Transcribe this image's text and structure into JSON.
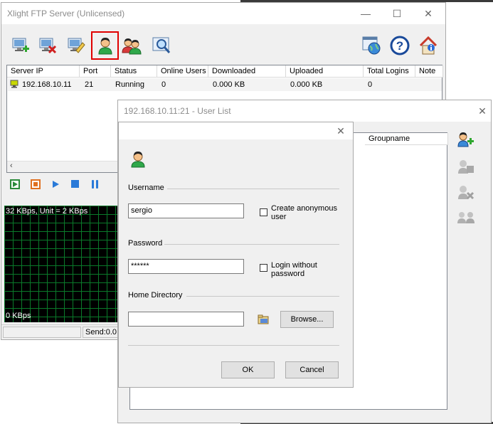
{
  "main_window": {
    "title": "Xlight FTP Server (Unlicensed)",
    "toolbar": {
      "add_server_icon": "add-server-icon",
      "delete_server_icon": "delete-server-icon",
      "edit_server_icon": "edit-server-icon",
      "user_list_icon": "user-icon",
      "groups_icon": "groups-icon",
      "find_icon": "find-icon",
      "web_icon": "web-icon",
      "help_icon": "help-icon",
      "about_icon": "about-icon"
    },
    "columns": [
      "Server IP",
      "Port",
      "Status",
      "Online Users",
      "Downloaded",
      "Uploaded",
      "Total Logins",
      "Note"
    ],
    "rows": [
      {
        "ip": "192.168.10.11",
        "port": "21",
        "status": "Running",
        "online_users": "0",
        "downloaded": "0.000 KB",
        "uploaded": "0.000 KB",
        "total_logins": "0"
      }
    ],
    "graph": {
      "top_label": "32 KBps, Unit = 2 KBps",
      "bottom_label": "0 KBps"
    },
    "status_send": "Send:0.0"
  },
  "user_list_window": {
    "title": "192.168.10.11:21 - User List",
    "groupname_header": "Groupname"
  },
  "dialog": {
    "username_label": "Username",
    "username_value": "sergio",
    "create_anonymous_label_1": "Create anonymous",
    "create_anonymous_label_2": "user",
    "password_label": "Password",
    "password_value": "******",
    "login_without_label_1": "Login without",
    "login_without_label_2": "password",
    "home_dir_label": "Home Directory",
    "home_dir_value": "",
    "browse_label": "Browse...",
    "ok_label": "OK",
    "cancel_label": "Cancel"
  }
}
